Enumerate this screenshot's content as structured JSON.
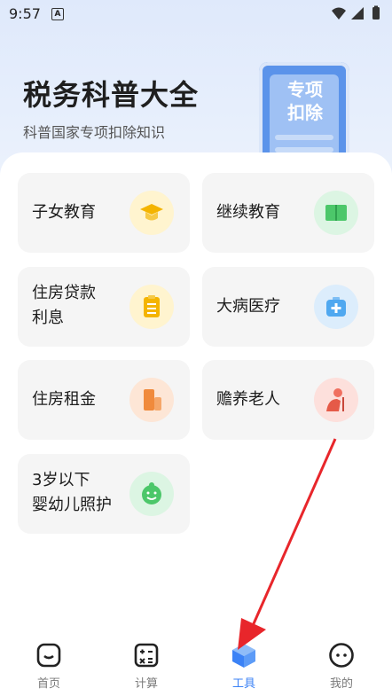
{
  "status_bar": {
    "time": "9:57",
    "notif_glyph": "A"
  },
  "header": {
    "title": "税务科普大全",
    "subtitle": "科普国家专项扣除知识"
  },
  "phone_illustration": {
    "text_line1": "专项",
    "text_line2": "扣除"
  },
  "cards": [
    {
      "label": "子女教育",
      "icon": "graduation-cap-icon",
      "color": "#f4c430"
    },
    {
      "label": "继续教育",
      "icon": "book-icon",
      "color": "#4cc76a"
    },
    {
      "label_line1": "住房贷款",
      "label_line2": "利息",
      "icon": "clipboard-icon",
      "color": "#f4c430"
    },
    {
      "label": "大病医疗",
      "icon": "medical-kit-icon",
      "color": "#4fa8f0"
    },
    {
      "label": "住房租金",
      "icon": "building-icon",
      "color": "#f08a3c"
    },
    {
      "label": "赡养老人",
      "icon": "elderly-person-icon",
      "color": "#f07060"
    },
    {
      "label_line1": "3岁以下",
      "label_line2": "婴幼儿照护",
      "icon": "baby-face-icon",
      "color": "#4cc76a"
    }
  ],
  "bottom_nav": [
    {
      "label": "首页",
      "icon": "home-icon"
    },
    {
      "label": "计算",
      "icon": "calculator-icon"
    },
    {
      "label": "工具",
      "icon": "cube-icon",
      "active": true
    },
    {
      "label": "我的",
      "icon": "profile-icon"
    }
  ],
  "colors": {
    "accent": "#3b82f6",
    "arrow": "#e8262b"
  }
}
